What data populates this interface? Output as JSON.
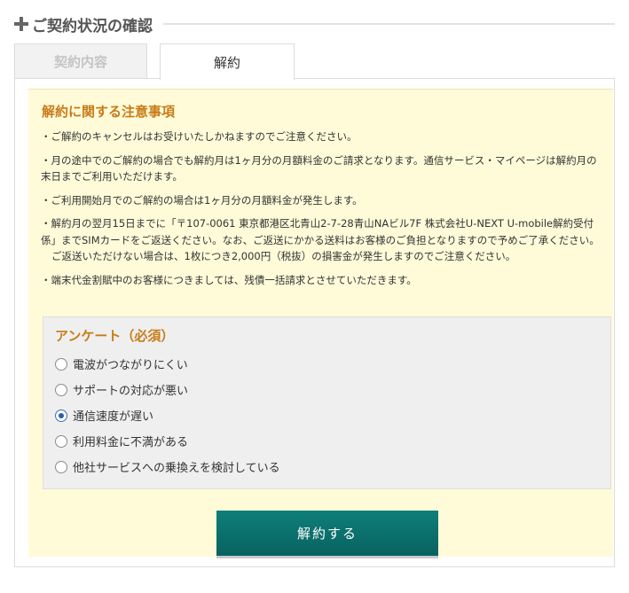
{
  "header": {
    "title": "ご契約状況の確認"
  },
  "tabs": [
    {
      "label": "契約内容",
      "active": false
    },
    {
      "label": "解約",
      "active": true
    }
  ],
  "notice": {
    "title": "解約に関する注意事項",
    "items": [
      "・ご解約のキャンセルはお受けいたしかねますのでご注意ください。",
      "・月の途中でのご解約の場合でも解約月は1ヶ月分の月額料金のご請求となります。通信サービス・マイページは解約月の末日までご利用いただけます。",
      "・ご利用開始月でのご解約の場合は1ヶ月分の月額料金が発生します。",
      "・解約月の翌月15日までに「〒107-0061 東京都港区北青山2-7-28青山NAビル7F 株式会社U-NEXT U-mobile解約受付係」までSIMカードをご返送ください。なお、ご返送にかかる送料はお客様のご負担となりますので予めご了承ください。",
      "ご返送いただけない場合は、1枚につき2,000円（税抜）の損害金が発生しますのでご注意ください。",
      "・端末代金割賦中のお客様につきましては、残債一括請求とさせていただきます。"
    ]
  },
  "survey": {
    "title": "アンケート（必須）",
    "options": [
      {
        "label": "電波がつながりにくい",
        "checked": false
      },
      {
        "label": "サポートの対応が悪い",
        "checked": false
      },
      {
        "label": "通信速度が遅い",
        "checked": true
      },
      {
        "label": "利用料金に不満がある",
        "checked": false
      },
      {
        "label": "他社サービスへの乗換えを検討している",
        "checked": false
      }
    ]
  },
  "actions": {
    "cancel_label": "解約する"
  },
  "colors": {
    "accent": "#c87b17",
    "button": "#0b706c",
    "notice_bg": "#fffbd9"
  }
}
